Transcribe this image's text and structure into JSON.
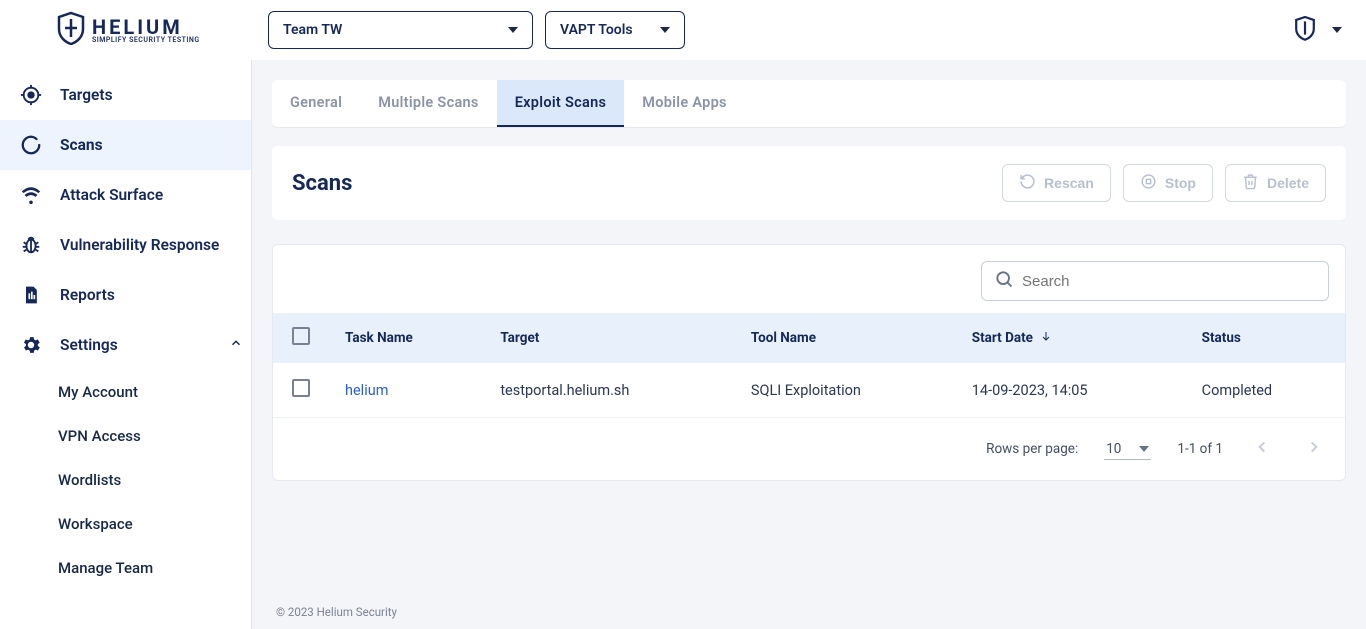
{
  "brand": {
    "title": "HELIUM",
    "subtitle": "SIMPLIFY SECURITY TESTING"
  },
  "header": {
    "team_selector": "Team TW",
    "tools_selector": "VAPT Tools"
  },
  "sidebar": {
    "items": [
      {
        "label": "Targets",
        "icon": "target-icon"
      },
      {
        "label": "Scans",
        "icon": "scan-icon",
        "active": true
      },
      {
        "label": "Attack Surface",
        "icon": "wifi-icon"
      },
      {
        "label": "Vulnerability Response",
        "icon": "bug-icon"
      },
      {
        "label": "Reports",
        "icon": "document-icon"
      },
      {
        "label": "Settings",
        "icon": "gear-icon",
        "expanded": true
      }
    ],
    "settings_children": [
      {
        "label": "My Account"
      },
      {
        "label": "VPN Access"
      },
      {
        "label": "Wordlists"
      },
      {
        "label": "Workspace"
      },
      {
        "label": "Manage Team"
      }
    ]
  },
  "tabs": [
    {
      "label": "General"
    },
    {
      "label": "Multiple Scans"
    },
    {
      "label": "Exploit Scans",
      "active": true
    },
    {
      "label": "Mobile Apps"
    }
  ],
  "page": {
    "title": "Scans"
  },
  "actions": {
    "rescan": "Rescan",
    "stop": "Stop",
    "delete": "Delete"
  },
  "search": {
    "placeholder": "Search"
  },
  "table": {
    "columns": {
      "task_name": "Task Name",
      "target": "Target",
      "tool_name": "Tool Name",
      "start_date": "Start Date",
      "status": "Status"
    },
    "rows": [
      {
        "task_name": "helium",
        "target": "testportal.helium.sh",
        "tool_name": "SQLI Exploitation",
        "start_date": "14-09-2023, 14:05",
        "status": "Completed"
      }
    ]
  },
  "pagination": {
    "rows_per_page_label": "Rows per page:",
    "rows_per_page_value": "10",
    "range_label": "1-1 of 1"
  },
  "footer": {
    "copyright": "© 2023 Helium Security"
  }
}
